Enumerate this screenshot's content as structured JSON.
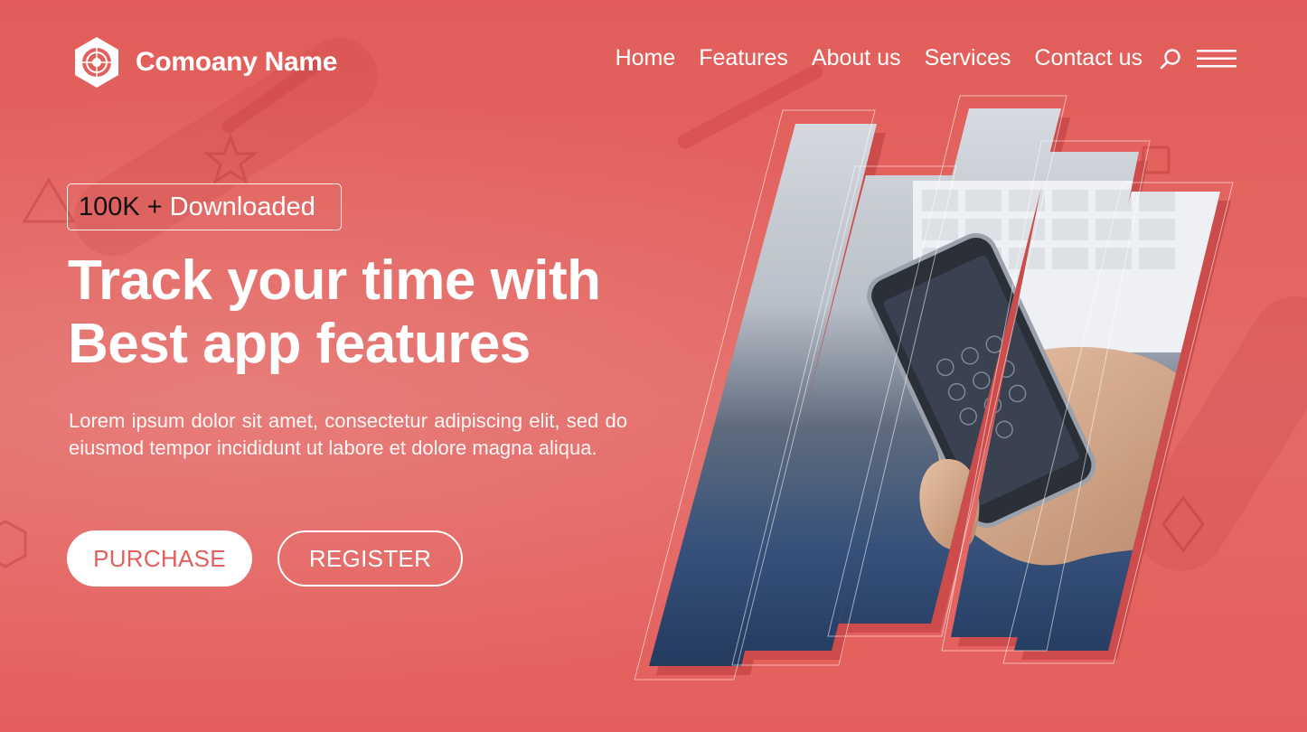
{
  "header": {
    "brand_name": "Comoany Name",
    "logo_icon": "hexagon-target-logo",
    "nav": [
      {
        "label": "Home"
      },
      {
        "label": "Features"
      },
      {
        "label": "About us"
      },
      {
        "label": "Services"
      },
      {
        "label": "Contact us"
      }
    ],
    "search_icon": "search-icon",
    "menu_icon": "hamburger-menu-icon"
  },
  "hero": {
    "badge": {
      "count": "100K",
      "separator": "+",
      "text": "Downloaded"
    },
    "headline": [
      "Track your time with",
      "Best app features"
    ],
    "description": "Lorem ipsum dolor sit amet, consectetur adipiscing elit, sed do eiusmod tempor incididunt ut labore et dolore magna aliqua.",
    "buttons": {
      "purchase": "PURCHASE",
      "register": "REGISTER"
    },
    "image": "smartphone-in-hand-photo"
  },
  "colors": {
    "background": "#e2605c",
    "button_text": "#e2605c",
    "accent_dark": "#c43d3d",
    "white": "#ffffff"
  }
}
